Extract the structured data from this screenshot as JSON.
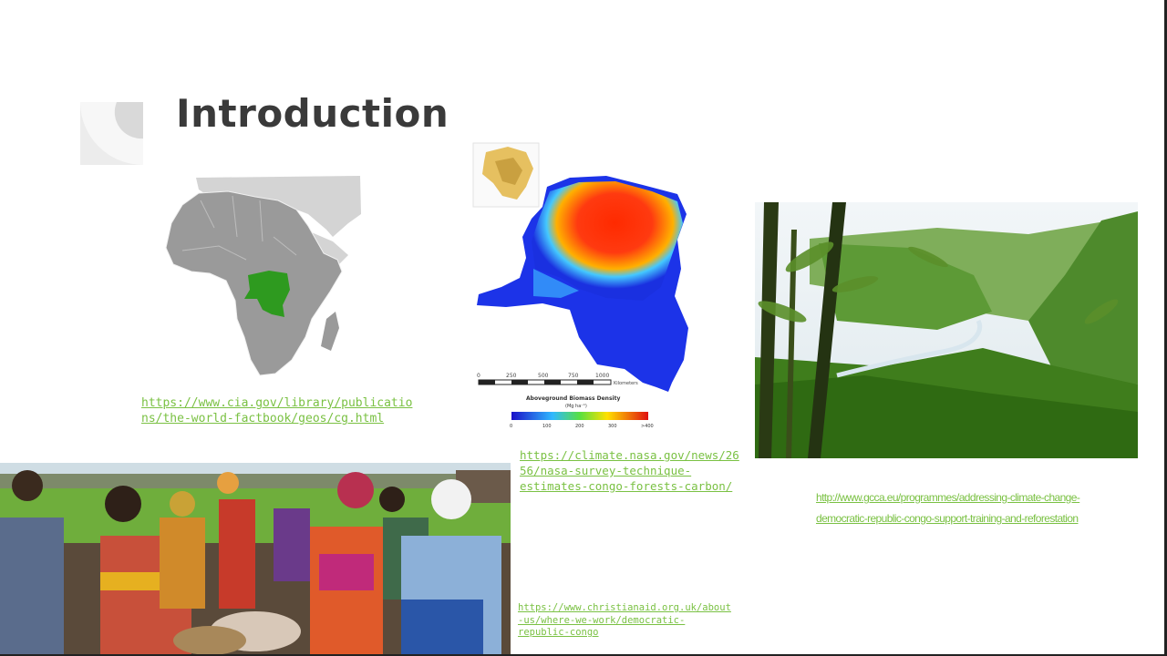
{
  "slide": {
    "title": "Introduction"
  },
  "links": {
    "cia": {
      "line1": "https://www.cia.gov/library/publicatio",
      "line2": "ns/the-world-factbook/geos/cg.html"
    },
    "nasa": {
      "line1": "https://climate.nasa.gov/news/26",
      "line2": "56/nasa-survey-technique-",
      "line3": "estimates-congo-forests-carbon/"
    },
    "gcca": {
      "line1": "http://www.gcca.eu/programmes/addressing-climate-change-",
      "line2": "democratic-republic-congo-support-training-and-reforestation"
    },
    "christianaid": {
      "line1": "https://www.christianaid.org.uk/about",
      "line2": "-us/where-we-work/democratic-",
      "line3": "republic-congo"
    }
  },
  "biomass_map": {
    "scale_labels": [
      "0",
      "250",
      "500",
      "750",
      "1000"
    ],
    "scale_unit": "Kilometers",
    "legend_title": "Aboveground Biomass Density",
    "legend_unit": "(Mg ha⁻¹)",
    "legend_ticks": [
      "0",
      "100",
      "200",
      "300",
      ">400"
    ]
  },
  "colors": {
    "title": "#3a3a3a",
    "link": "#7ac143",
    "drc_highlight": "#2e9a1f"
  }
}
